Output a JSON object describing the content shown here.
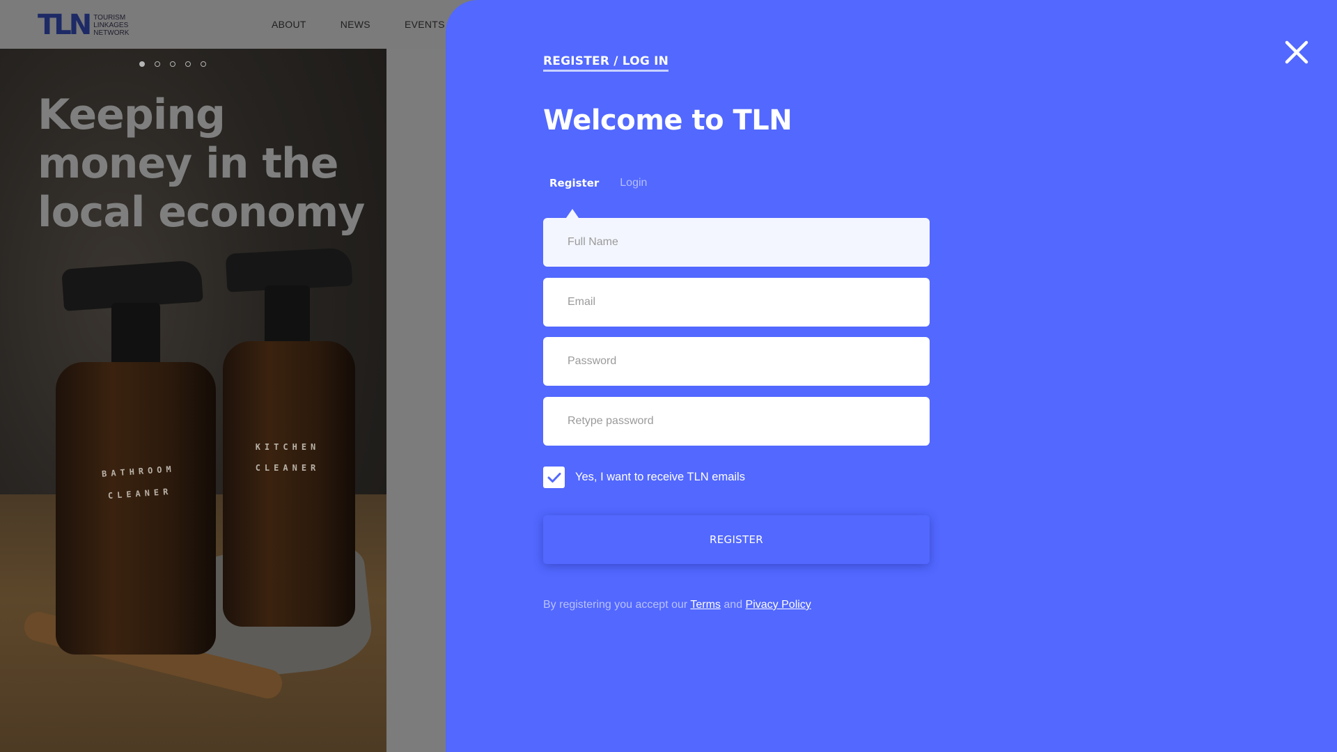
{
  "header": {
    "logo_mark": "TLN",
    "logo_text": [
      "TOURISM",
      "LINKAGES",
      "NETWORK"
    ],
    "nav": [
      "ABOUT",
      "NEWS",
      "EVENTS"
    ]
  },
  "hero": {
    "slides_total": 5,
    "active_slide": 1,
    "title": "Keeping money in the local economy",
    "bottle_labels": [
      {
        "line1": "BATHROOM",
        "line2": "CLEANER"
      },
      {
        "line1": "KITCHEN",
        "line2": "CLEANER"
      }
    ]
  },
  "modal": {
    "eyebrow": "REGISTER / LOG IN",
    "welcome": "Welcome to TLN",
    "tabs": [
      {
        "label": "Register",
        "active": true
      },
      {
        "label": "Login",
        "active": false
      }
    ],
    "fields": {
      "full_name": {
        "placeholder": "Full Name",
        "value": ""
      },
      "email": {
        "placeholder": "Email",
        "value": ""
      },
      "password": {
        "placeholder": "Password",
        "value": ""
      },
      "retype_password": {
        "placeholder": "Retype password",
        "value": ""
      }
    },
    "opt_in": {
      "label": "Yes, I want to receive TLN emails",
      "checked": true
    },
    "submit_label": "REGISTER",
    "legal": {
      "prefix": "By registering you accept our",
      "terms": "Terms",
      "and": "and",
      "privacy": "Pivacy Policy"
    },
    "close_icon": "close-icon"
  },
  "colors": {
    "panel": "#5268ff",
    "accent_underline": "#c9d2ff",
    "checkmark": "#5268ff"
  }
}
